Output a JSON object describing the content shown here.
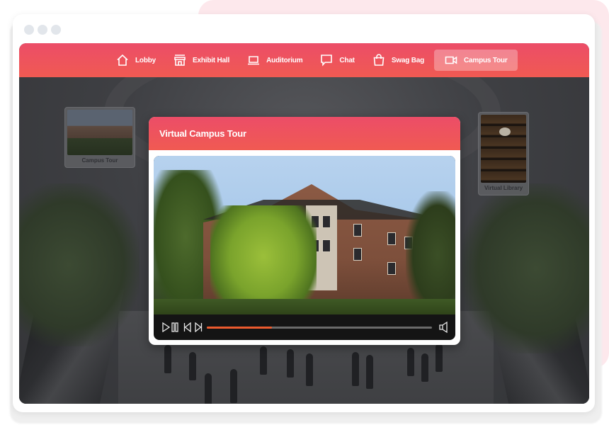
{
  "window": {
    "controls": [
      "window-dot",
      "window-dot",
      "window-dot"
    ]
  },
  "nav": {
    "items": [
      {
        "label": "Lobby",
        "icon": "home-icon",
        "active": false
      },
      {
        "label": "Exhibit Hall",
        "icon": "storefront-icon",
        "active": false
      },
      {
        "label": "Auditorium",
        "icon": "laptop-icon",
        "active": false
      },
      {
        "label": "Chat",
        "icon": "chat-bubble-icon",
        "active": false
      },
      {
        "label": "Swag Bag",
        "icon": "shopping-bag-icon",
        "active": false
      },
      {
        "label": "Campus Tour",
        "icon": "video-camera-icon",
        "active": true
      }
    ]
  },
  "scene": {
    "signs": [
      {
        "label": "Campus Tour"
      },
      {
        "label": "Virtual Library"
      }
    ]
  },
  "modal": {
    "title": "Virtual Campus Tour",
    "video": {
      "progress_percent": 29,
      "controls": [
        "play-icon",
        "pause-icon",
        "skip-back-icon",
        "skip-forward-icon",
        "volume-icon"
      ]
    }
  },
  "colors": {
    "brand_gradient_top": "#ec4d68",
    "brand_gradient_bottom": "#f05a52",
    "progress_fill": "#ec5a2e",
    "progress_track": "#6a6a6a",
    "player_bar": "#141414",
    "window_dot": "#e2e6eb",
    "page_accent_bg": "#fde8ec"
  }
}
